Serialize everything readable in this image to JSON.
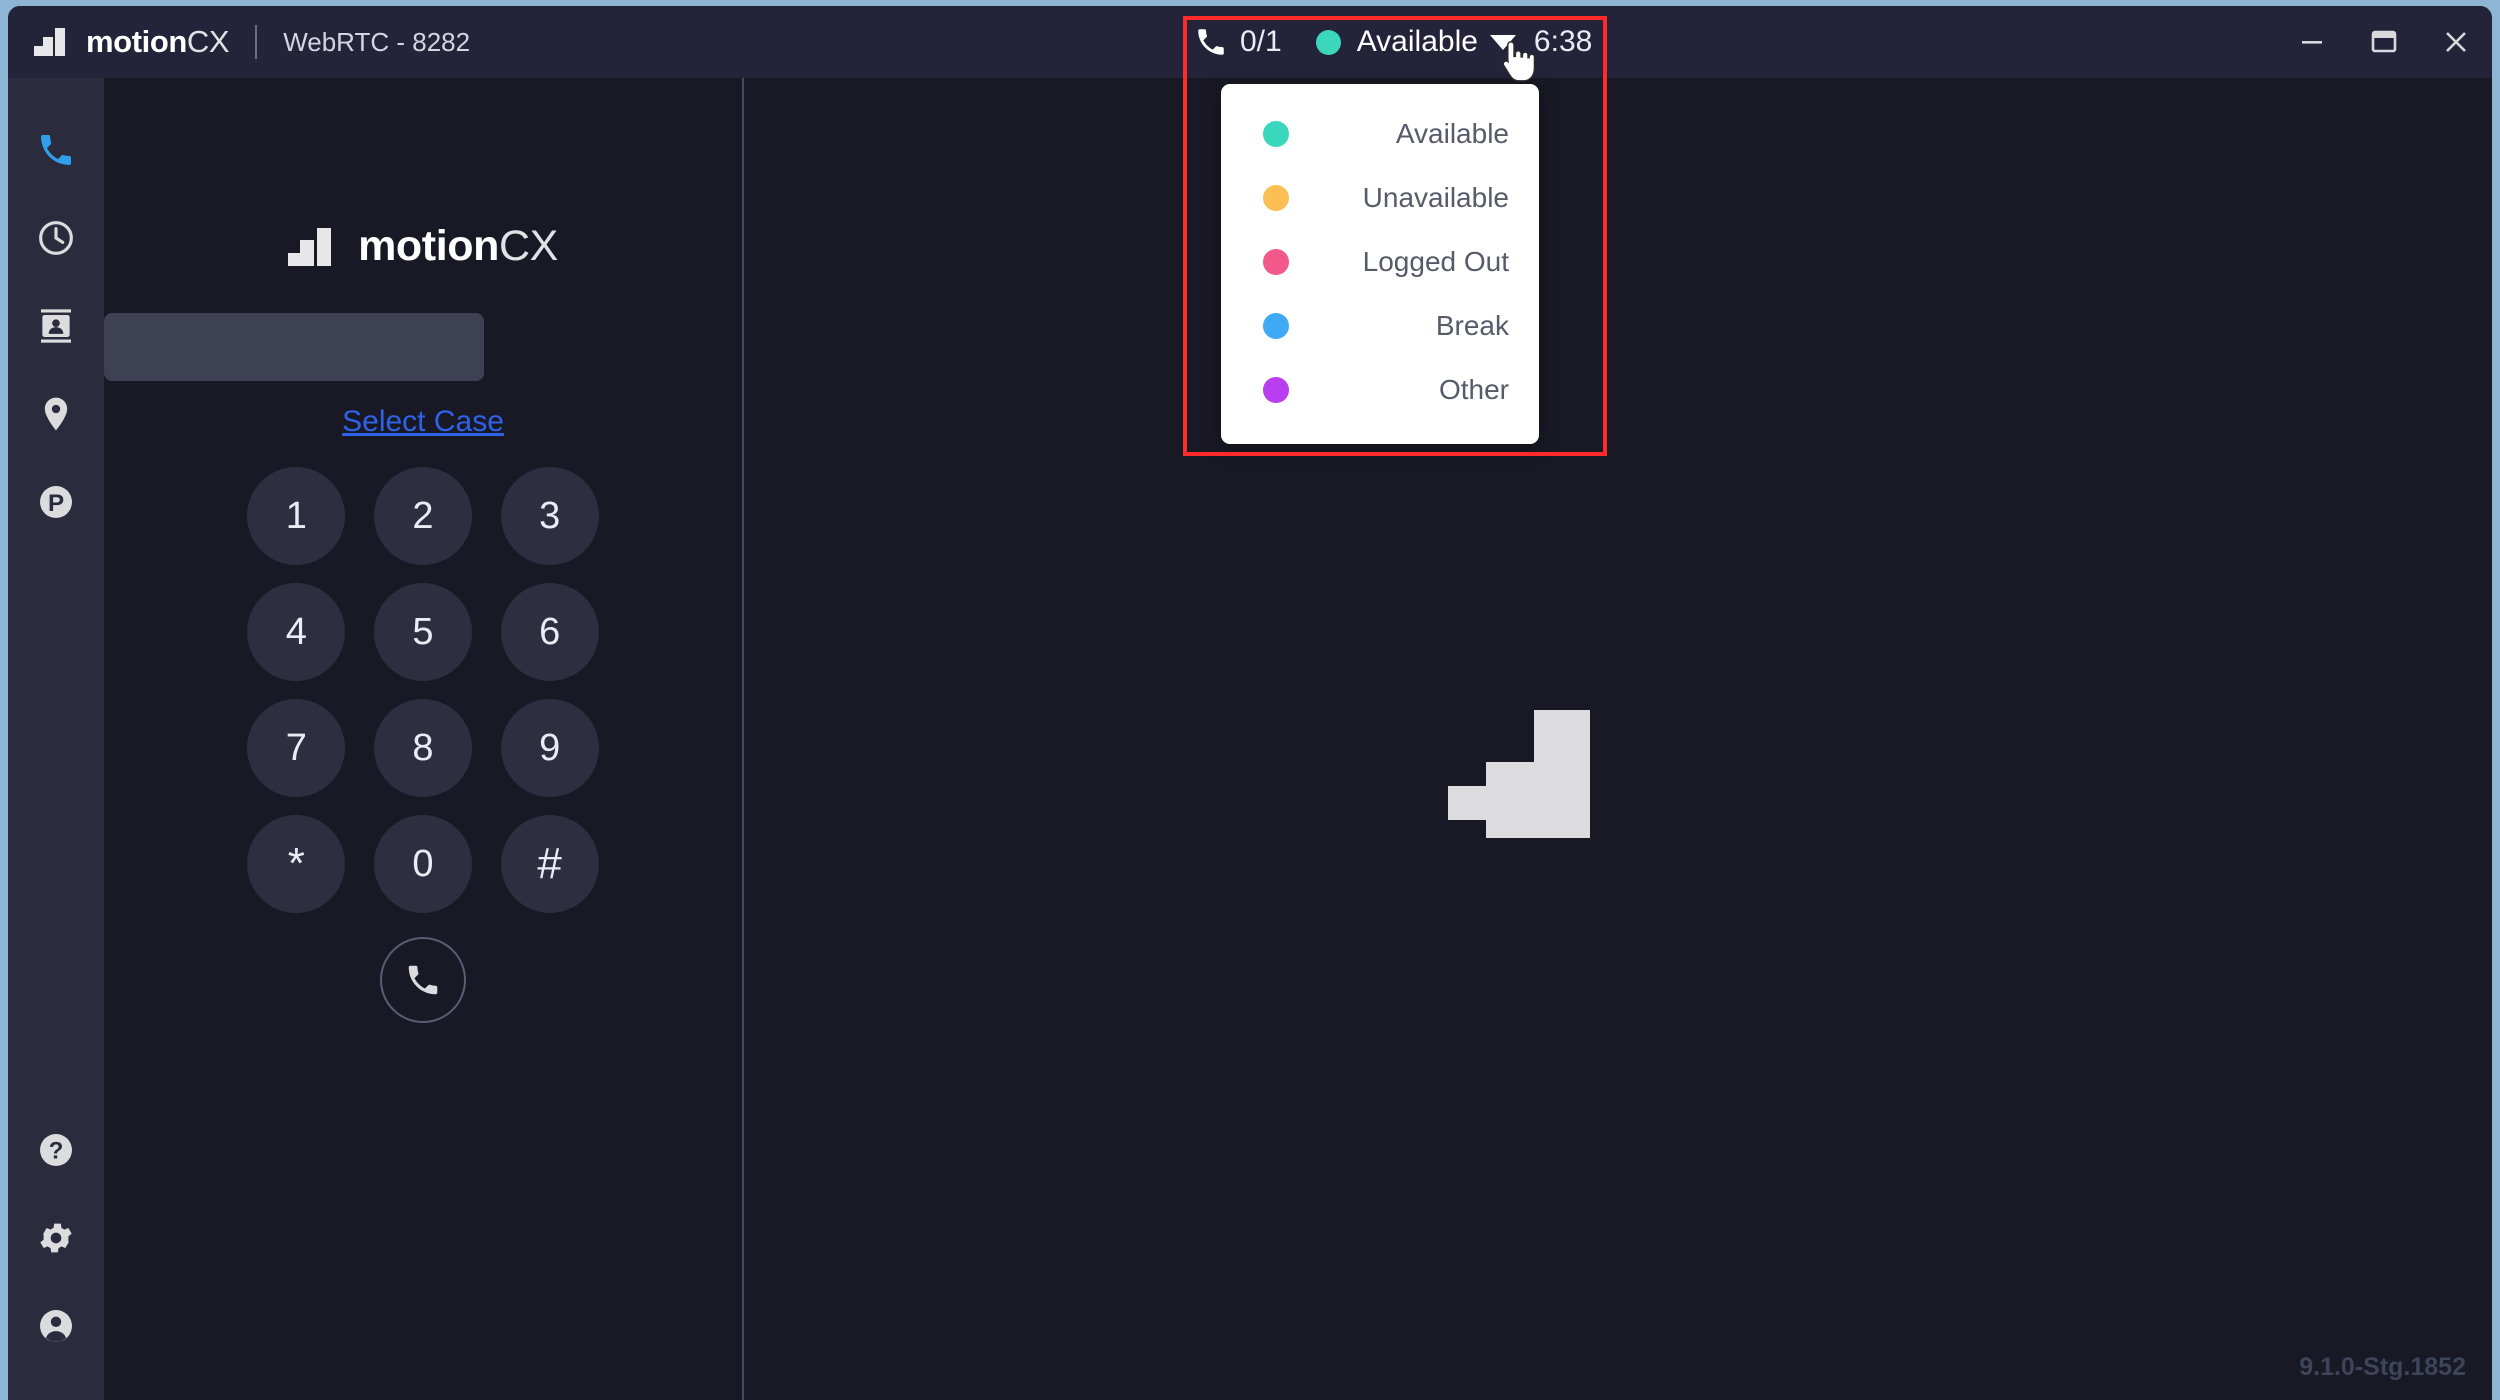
{
  "titlebar": {
    "brand_bold": "motion",
    "brand_light": "CX",
    "subtitle": "WebRTC - 8282",
    "logo_icon": "motioncx-bars-logo"
  },
  "status": {
    "phone_icon": "phone-handset-icon",
    "calls_count": "0/1",
    "current_status": "Available",
    "current_status_color": "#3ad7bd",
    "caret_icon": "caret-down-icon",
    "timer": "6:38",
    "cursor_icon": "pointing-hand-cursor"
  },
  "status_dropdown": {
    "items": [
      {
        "label": "Available",
        "color": "#3ad7bd"
      },
      {
        "label": "Unavailable",
        "color": "#fcbf54"
      },
      {
        "label": "Logged Out",
        "color": "#f2588a"
      },
      {
        "label": "Break",
        "color": "#3fa9f5"
      },
      {
        "label": "Other",
        "color": "#b83ef0"
      }
    ]
  },
  "window_controls": {
    "minimize": "minimize-icon",
    "maximize": "maximize-icon",
    "close": "close-icon"
  },
  "sidebar": {
    "top_items": [
      {
        "name": "sidebar-item-dialer",
        "icon": "phone-icon",
        "active": true
      },
      {
        "name": "sidebar-item-history",
        "icon": "clock-icon",
        "active": false
      },
      {
        "name": "sidebar-item-contacts",
        "icon": "contact-card-icon",
        "active": false
      },
      {
        "name": "sidebar-item-location",
        "icon": "map-pin-icon",
        "active": false
      },
      {
        "name": "sidebar-item-parking",
        "icon": "parking-p-icon",
        "active": false
      }
    ],
    "bottom_items": [
      {
        "name": "sidebar-item-help",
        "icon": "help-question-icon"
      },
      {
        "name": "sidebar-item-settings",
        "icon": "gear-icon"
      },
      {
        "name": "sidebar-item-account",
        "icon": "user-avatar-icon"
      }
    ],
    "active_color": "#2f9fe8"
  },
  "dialer": {
    "brand_bold": "motion",
    "brand_light": "CX",
    "number_value": "",
    "number_placeholder": "",
    "select_case_label": "Select Case",
    "keys": [
      "1",
      "2",
      "3",
      "4",
      "5",
      "6",
      "7",
      "8",
      "9",
      "*",
      "0",
      "#"
    ],
    "call_icon": "phone-call-icon"
  },
  "main": {
    "watermark_icon": "motioncx-bars-watermark",
    "version": "9.1.0-Stg.1852"
  }
}
